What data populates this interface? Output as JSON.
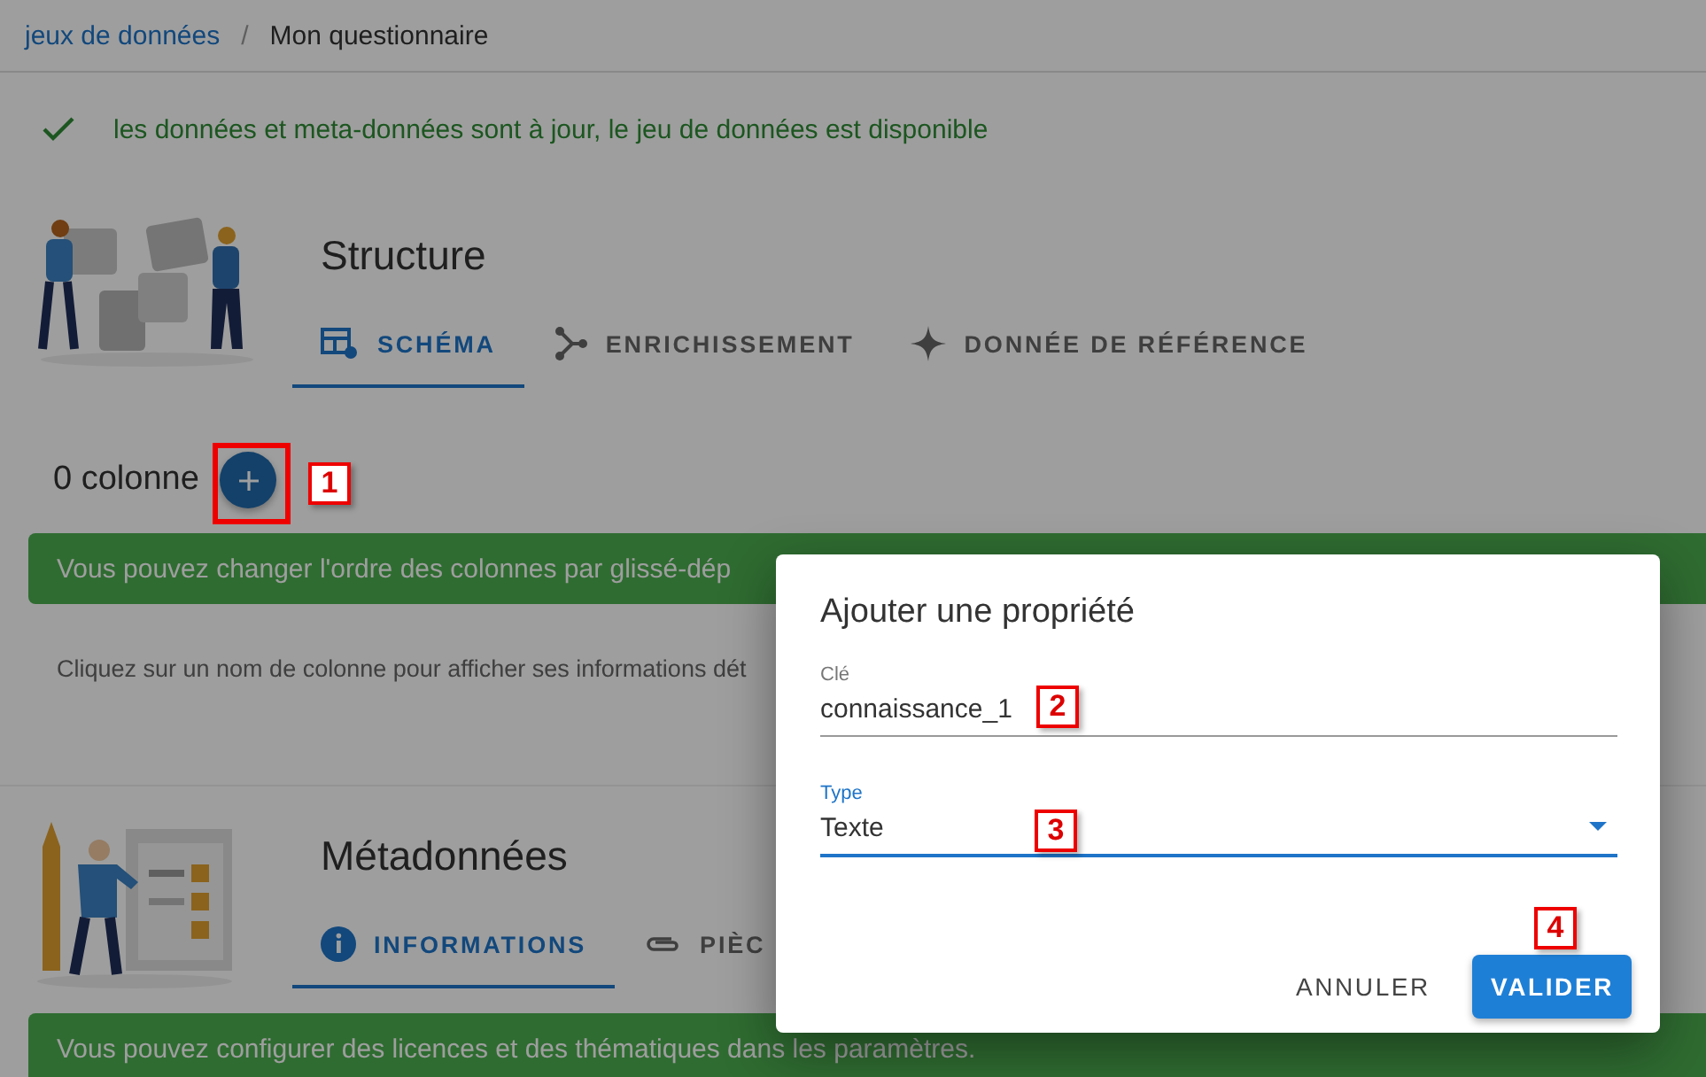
{
  "breadcrumb": [
    {
      "label": "jeux de données",
      "kind": "link"
    },
    {
      "label": "Mon questionnaire",
      "kind": "current"
    }
  ],
  "breadcrumb_separator": "/",
  "status_alert": {
    "text": "les données et meta-données sont à jour, le jeu de données est disponible"
  },
  "structure": {
    "title": "Structure",
    "tabs": [
      {
        "label": "SCHÉMA",
        "selected": true
      },
      {
        "label": "ENRICHISSEMENT",
        "selected": false
      },
      {
        "label": "DONNÉE DE RÉFÉRENCE",
        "selected": false
      }
    ],
    "columns_count": "0 colonne",
    "banner": "Vous pouvez changer l'ordre des colonnes par glissé-dép",
    "hint": "Cliquez sur un nom de colonne pour afficher ses informations dét"
  },
  "metadata": {
    "title": "Métadonnées",
    "tabs": [
      {
        "label": "INFORMATIONS",
        "selected": true
      },
      {
        "label": "PIÈC",
        "selected": false
      }
    ],
    "banner": "Vous pouvez configurer des licences et des thématiques dans les paramètres."
  },
  "dialog": {
    "title": "Ajouter une propriété",
    "fields": [
      {
        "label": "Clé",
        "value": "connaissance_1",
        "kind": "text",
        "focused": false
      },
      {
        "label": "Type",
        "value": "Texte",
        "kind": "select",
        "focused": true
      }
    ],
    "buttons": [
      {
        "label": "ANNULER",
        "kind": "text"
      },
      {
        "label": "VALIDER",
        "kind": "primary"
      }
    ]
  },
  "annotations": [
    "1",
    "2",
    "3",
    "4"
  ]
}
